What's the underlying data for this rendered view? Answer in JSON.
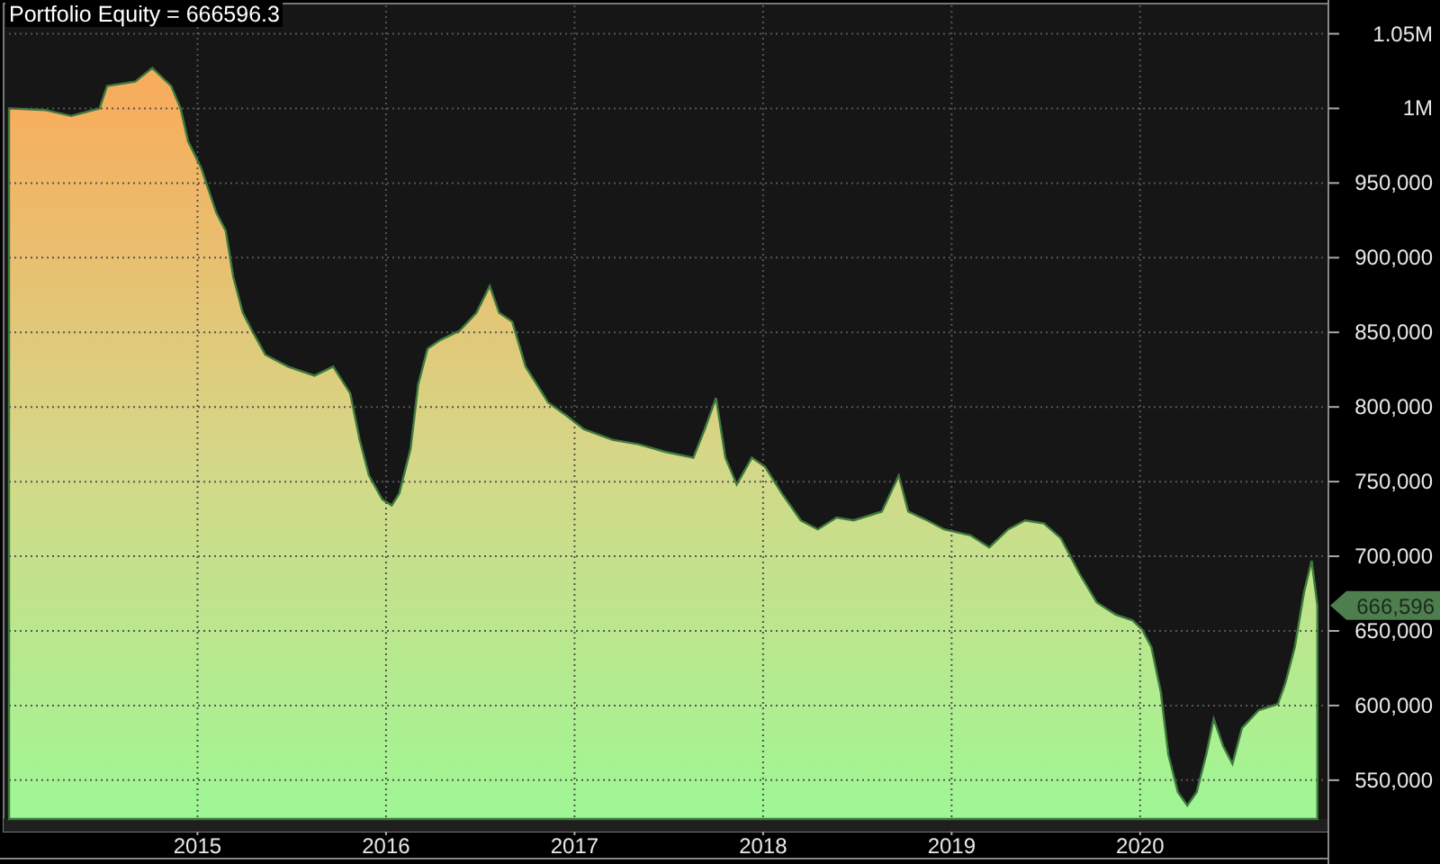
{
  "title_value": "= 666596.3",
  "last_value_label": "666,596",
  "chart_data": {
    "type": "area",
    "grid": true,
    "ylim": [
      524000,
      1069000
    ],
    "xlim": [
      2014.0,
      2020.97
    ],
    "yticks": [
      {
        "value": 550000,
        "label": "550,000"
      },
      {
        "value": 600000,
        "label": "600,000"
      },
      {
        "value": 650000,
        "label": "650,000"
      },
      {
        "value": 700000,
        "label": "700,000"
      },
      {
        "value": 750000,
        "label": "750,000"
      },
      {
        "value": 800000,
        "label": "800,000"
      },
      {
        "value": 850000,
        "label": "850,000"
      },
      {
        "value": 900000,
        "label": "900,000"
      },
      {
        "value": 950000,
        "label": "950,000"
      },
      {
        "value": 1000000,
        "label": "1M"
      },
      {
        "value": 1050000,
        "label": "1.05M"
      }
    ],
    "xticks": [
      {
        "value": 2015,
        "label": "2015"
      },
      {
        "value": 2016,
        "label": "2016"
      },
      {
        "value": 2017,
        "label": "2017"
      },
      {
        "value": 2018,
        "label": "2018"
      },
      {
        "value": 2019,
        "label": "2019"
      },
      {
        "value": 2020,
        "label": "2020"
      }
    ],
    "x": [
      2014.0,
      2014.19,
      2014.33,
      2014.48,
      2014.52,
      2014.67,
      2014.76,
      2014.86,
      2014.91,
      2014.95,
      2015.02,
      2015.1,
      2015.15,
      2015.19,
      2015.24,
      2015.29,
      2015.36,
      2015.48,
      2015.62,
      2015.72,
      2015.81,
      2015.86,
      2015.91,
      2015.98,
      2016.03,
      2016.07,
      2016.13,
      2016.17,
      2016.22,
      2016.29,
      2016.39,
      2016.48,
      2016.55,
      2016.6,
      2016.67,
      2016.74,
      2016.8,
      2016.86,
      2016.96,
      2017.05,
      2017.2,
      2017.34,
      2017.48,
      2017.63,
      2017.69,
      2017.75,
      2017.8,
      2017.86,
      2017.94,
      2018.01,
      2018.1,
      2018.2,
      2018.29,
      2018.39,
      2018.48,
      2018.63,
      2018.72,
      2018.77,
      2018.87,
      2018.96,
      2019.1,
      2019.2,
      2019.3,
      2019.39,
      2019.49,
      2019.58,
      2019.68,
      2019.77,
      2019.87,
      2019.96,
      2020.01,
      2020.06,
      2020.11,
      2020.15,
      2020.2,
      2020.25,
      2020.3,
      2020.35,
      2020.39,
      2020.44,
      2020.49,
      2020.54,
      2020.63,
      2020.73,
      2020.77,
      2020.82,
      2020.87,
      2020.91,
      2020.94
    ],
    "series": [
      {
        "name": "Portfolio Equity",
        "color": "#3d7a3d",
        "values": [
          1000000,
          999000,
          995000,
          1000000,
          1015000,
          1018000,
          1027000,
          1015000,
          1000000,
          978000,
          960000,
          930000,
          918000,
          887000,
          863000,
          851000,
          835000,
          827000,
          821000,
          827000,
          809000,
          778000,
          754000,
          738000,
          734000,
          742000,
          772000,
          815000,
          839000,
          845000,
          851000,
          863000,
          881000,
          863000,
          857000,
          827000,
          815000,
          803000,
          794000,
          785000,
          778000,
          775000,
          770000,
          766000,
          785000,
          806000,
          766000,
          748000,
          766000,
          760000,
          742000,
          724000,
          718000,
          726000,
          724000,
          730000,
          754000,
          730000,
          724000,
          718000,
          714000,
          706000,
          718000,
          724000,
          722000,
          712000,
          688000,
          669000,
          661000,
          657000,
          651000,
          639000,
          609000,
          567000,
          542000,
          533000,
          542000,
          567000,
          591000,
          573000,
          561000,
          585000,
          597000,
          601000,
          615000,
          639000,
          676000,
          697000,
          667000
        ]
      }
    ]
  }
}
